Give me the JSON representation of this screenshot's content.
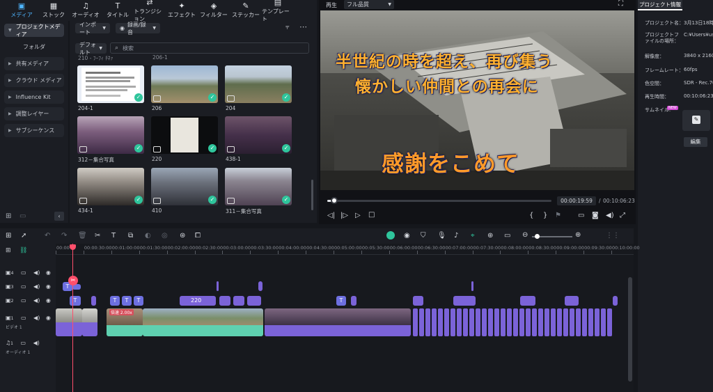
{
  "toolbar": {
    "items": [
      {
        "label": "メディア",
        "icon": "media-icon"
      },
      {
        "label": "ストック",
        "icon": "stock-icon"
      },
      {
        "label": "オーディオ",
        "icon": "music-icon"
      },
      {
        "label": "タイトル",
        "icon": "title-icon"
      },
      {
        "label": "トランジション",
        "icon": "transition-icon"
      },
      {
        "label": "エフェクト",
        "icon": "effect-icon"
      },
      {
        "label": "フィルター",
        "icon": "filter-icon"
      },
      {
        "label": "ステッカー",
        "icon": "sticker-icon"
      },
      {
        "label": "テンプレート",
        "icon": "template-icon"
      }
    ]
  },
  "sidebar": {
    "items": [
      {
        "label": "プロジェクトメディア"
      },
      {
        "label": "フォルダ"
      },
      {
        "label": "共有メディア"
      },
      {
        "label": "クラウド メディア"
      },
      {
        "label": "Influence Kit"
      },
      {
        "label": "調整レイヤー"
      },
      {
        "label": "サブシーケンス"
      }
    ]
  },
  "media": {
    "import_label": "インポート",
    "record_label": "録画/録音",
    "sort_label": "デフォルト",
    "search_placeholder": "検索",
    "partial_labels": [
      "210 - ﾌｰﾌｨ ﾁﾈｧ",
      "206-1"
    ],
    "items": [
      {
        "label": "204-1"
      },
      {
        "label": "206"
      },
      {
        "label": "204"
      },
      {
        "label": "312－集合写真"
      },
      {
        "label": "220"
      },
      {
        "label": "438-1"
      },
      {
        "label": "434-1"
      },
      {
        "label": "410"
      },
      {
        "label": "311－集合写真"
      }
    ]
  },
  "preview": {
    "tab_play": "再生",
    "quality": "フル品質",
    "title_line1": "半世紀の時を超え、再び集う",
    "title_line2": "懐かしい仲間との再会に",
    "title_line3": "感謝をこめて",
    "current_time": "00:00:19:59",
    "separator": "/",
    "total_time": "00:10:06:23",
    "progress": 0.032
  },
  "info": {
    "tab": "プロジェクト情報",
    "rows": [
      {
        "label": "プロジェクト名：",
        "value": "3月13日18時"
      },
      {
        "label": "プロジェクトファイルの場所：",
        "value": "C:¥Users¥use"
      },
      {
        "label": "解像度：",
        "value": "3840 x 2160"
      },
      {
        "label": "フレームレート：",
        "value": "60fps"
      },
      {
        "label": "色空間：",
        "value": "SDR - Rec.709"
      },
      {
        "label": "再生時間：",
        "value": "00:10:06:23"
      }
    ],
    "thumbnail_label": "サムネイル:",
    "new_badge": "NEW",
    "edit_button": "編集"
  },
  "timeline": {
    "ticks": [
      "00:00",
      "00:00:30:00",
      "00:01:00:00",
      "00:01:30:00",
      "00:02:00:00",
      "00:02:30:00",
      "00:03:00:00",
      "00:03:30:00",
      "00:04:00:00",
      "00:04:30:00",
      "00:05:00:00",
      "00:05:30:00",
      "00:06:00:00",
      "00:06:30:00",
      "00:07:00:00",
      "00:07:30:00",
      "00:08:00:00",
      "00:08:30:00",
      "00:09:00:00",
      "00:09:30:00",
      "00:10:00:00"
    ],
    "tracks": [
      {
        "num": "4"
      },
      {
        "num": "3"
      },
      {
        "num": "2"
      },
      {
        "num": "1",
        "name": "ビデオ 1"
      },
      {
        "num": "1",
        "name": "オーディオ 1"
      }
    ],
    "clip_labels": {
      "c220": "220",
      "speed": "倍速 2.00x",
      "title": "T"
    }
  },
  "colors": {
    "accent": "#4fb6ff",
    "clip_purple": "#7b63d8",
    "title_clip": "#6d6fe0",
    "check": "#2fc59c",
    "playhead": "#ff4f6b"
  }
}
